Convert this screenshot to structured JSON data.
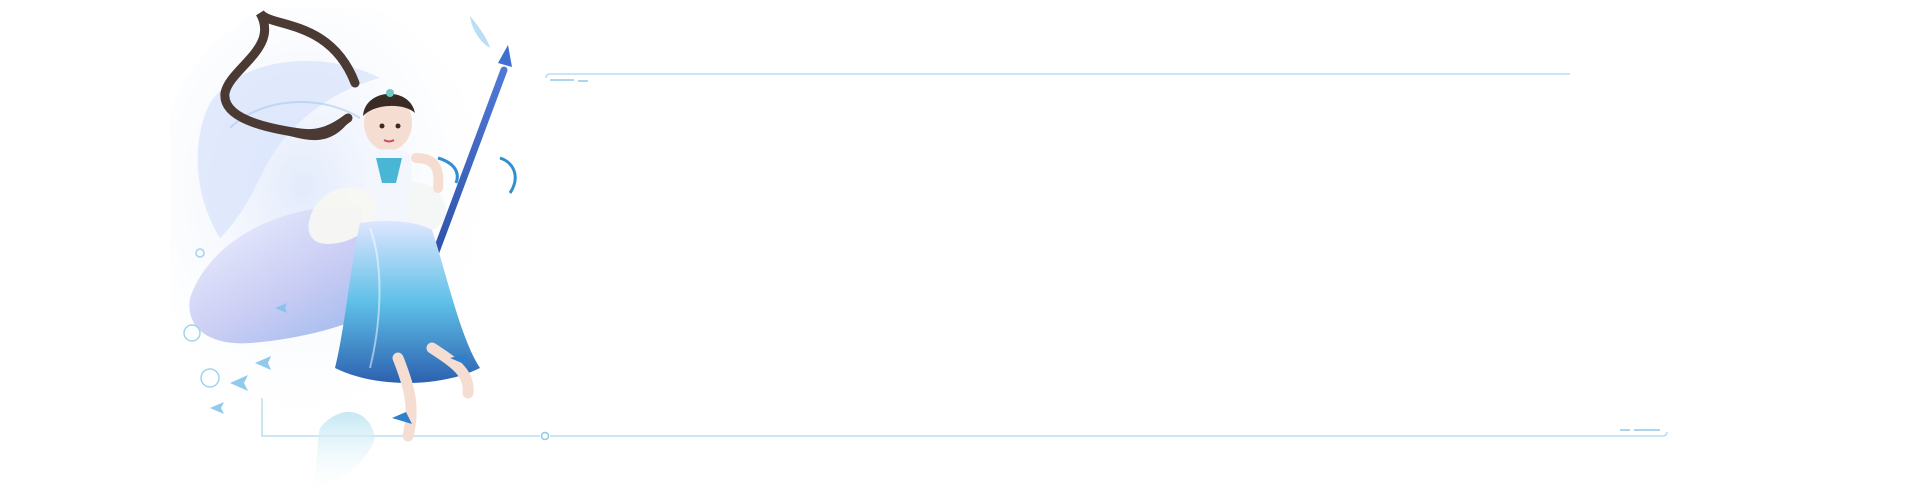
{
  "banner": {
    "accent_color": "#8ec9e8",
    "line_color": "#b9ddf0",
    "character_icon": "dancer-with-spear-icon",
    "koi_icon": "koi-fish-icon"
  }
}
